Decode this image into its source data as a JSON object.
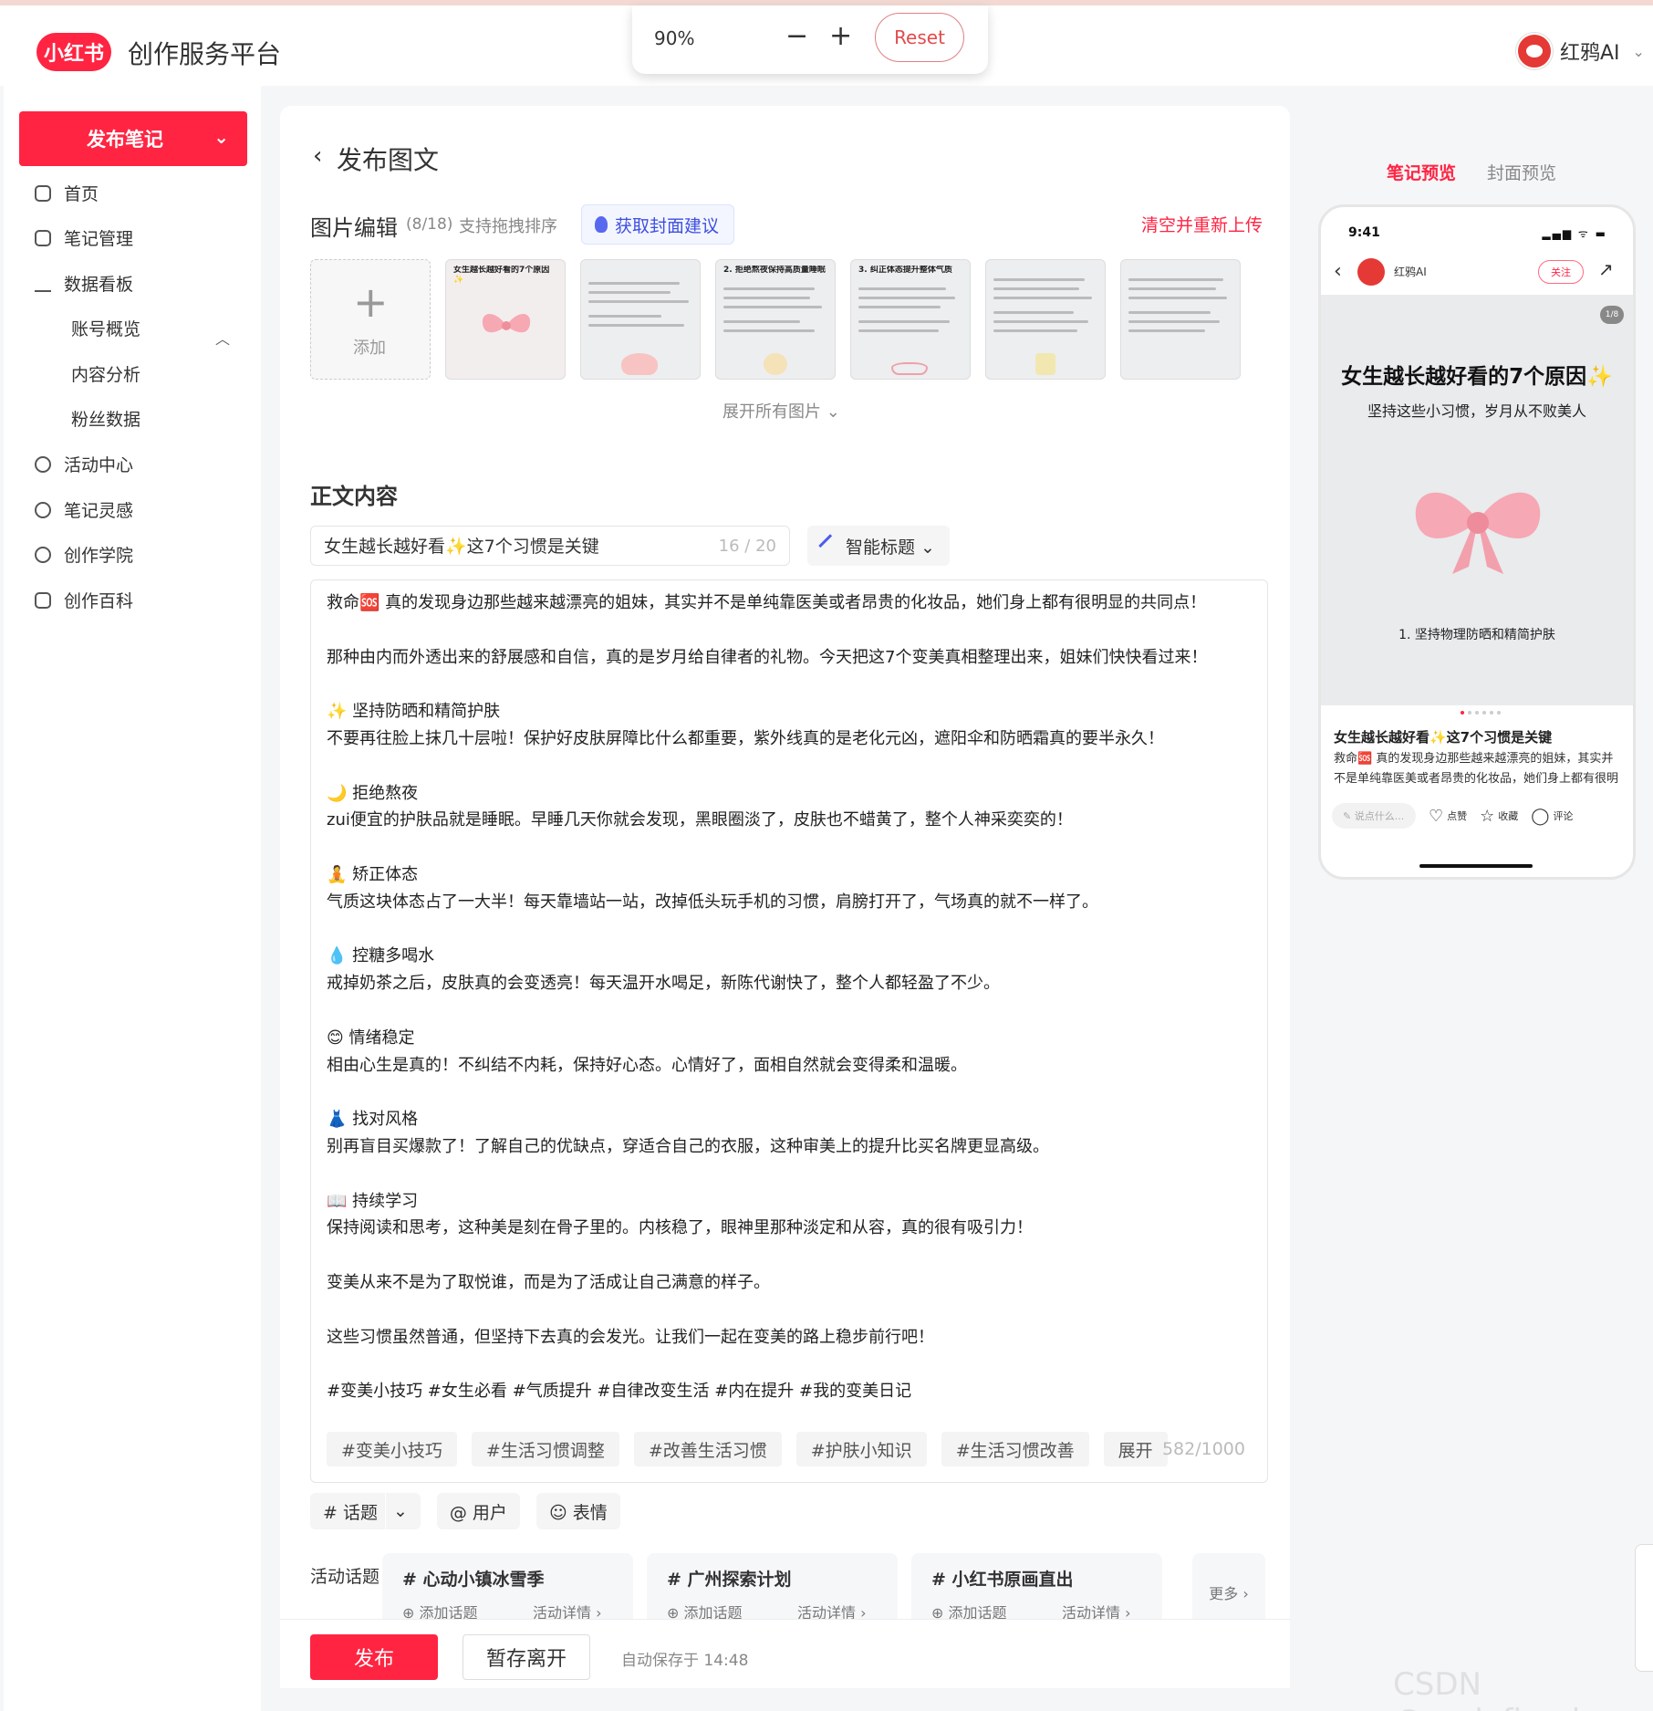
{
  "header": {
    "logo": "小红书",
    "title": "创作服务平台",
    "zoom": {
      "level": "90%",
      "minus": "−",
      "plus": "+",
      "reset": "Reset"
    },
    "user": {
      "name": "红鸦AI",
      "chevron": "⌄"
    }
  },
  "sidebar": {
    "publish_label": "发布笔记",
    "publish_chevron": "⌄",
    "items": [
      {
        "label": "首页",
        "icon": "home-icon"
      },
      {
        "label": "笔记管理",
        "icon": "note-icon"
      },
      {
        "label": "数据看板",
        "icon": "chart-icon"
      },
      {
        "label": "账号概览"
      },
      {
        "label": "内容分析"
      },
      {
        "label": "粉丝数据"
      },
      {
        "label": "活动中心",
        "icon": "activity-icon"
      },
      {
        "label": "笔记灵感",
        "icon": "inspiration-icon"
      },
      {
        "label": "创作学院",
        "icon": "academy-icon"
      },
      {
        "label": "创作百科",
        "icon": "wiki-icon"
      }
    ],
    "collapse_icon": "︿"
  },
  "page": {
    "back_icon": "‹",
    "title": "发布图文",
    "image_edit": {
      "title": "图片编辑",
      "count": "(8/18)",
      "hint": "支持拖拽排序",
      "cover_suggest": "获取封面建议",
      "clear_reupload": "清空并重新上传",
      "add_plus": "+",
      "add_label": "添加",
      "expand": "展开所有图片 ⌄",
      "thumbs": [
        {
          "title": "女生越长越好看的7个原因✨"
        },
        {
          "title": ""
        },
        {
          "title": "2. 拒绝熬夜保持高质量睡眠"
        },
        {
          "title": "3. 纠正体态提升整体气质"
        },
        {
          "title": ""
        },
        {
          "title": ""
        }
      ]
    },
    "body": {
      "title": "正文内容",
      "title_input": "女生越长越好看✨这7个习惯是关键",
      "title_count": "16 / 20",
      "smart_title": "智能标题 ⌄",
      "text": "救命🆘 真的发现身边那些越来越漂亮的姐妹，其实并不是单纯靠医美或者昂贵的化妆品，她们身上都有很明显的共同点！\n\n那种由内而外透出来的舒展感和自信，真的是岁月给自律者的礼物。今天把这7个变美真相整理出来，姐妹们快快看过来！\n\n✨ 坚持防晒和精简护肤\n不要再往脸上抹几十层啦！保护好皮肤屏障比什么都重要，紫外线真的是老化元凶，遮阳伞和防晒霜真的要半永久！\n\n🌙 拒绝熬夜\nzui便宜的护肤品就是睡眠。早睡几天你就会发现，黑眼圈淡了，皮肤也不蜡黄了，整个人神采奕奕的！\n\n🧘 矫正体态\n气质这块体态占了一大半！每天靠墙站一站，改掉低头玩手机的习惯，肩膀打开了，气场真的就不一样了。\n\n💧 控糖多喝水\n戒掉奶茶之后，皮肤真的会变透亮！每天温开水喝足，新陈代谢快了，整个人都轻盈了不少。\n\n😊 情绪稳定\n相由心生是真的！不纠结不内耗，保持好心态。心情好了，面相自然就会变得柔和温暖。\n\n👗 找对风格\n别再盲目买爆款了！了解自己的优缺点，穿适合自己的衣服，这种审美上的提升比买名牌更显高级。\n\n📖 持续学习\n保持阅读和思考，这种美是刻在骨子里的。内核稳了，眼神里那种淡定和从容，真的很有吸引力！\n\n变美从来不是为了取悦谁，而是为了活成让自己满意的样子。\n\n这些习惯虽然普通，但坚持下去真的会发光。让我们一起在变美的路上稳步前行吧！\n\n#变美小技巧 #女生必看 #气质提升 #自律改变生活 #内在提升 #我的变美日记",
      "tag_chips": [
        "#变美小技巧",
        "#生活习惯调整",
        "#改善生活习惯",
        "#护肤小知识",
        "#生活习惯改善",
        "展开"
      ],
      "text_count": "582/1000"
    },
    "tools": {
      "topic": "# 话题",
      "topic_chevron": "⌄",
      "user": "@ 用户",
      "emoji": "☺ 表情"
    },
    "activity": {
      "label": "活动话题",
      "cards": [
        {
          "title": "# 心动小镇冰雪季",
          "add": "⊕ 添加话题",
          "detail": "活动详情 ›"
        },
        {
          "title": "# 广州探索计划",
          "add": "⊕ 添加话题",
          "detail": "活动详情 ›"
        },
        {
          "title": "# 小红书原画直出",
          "add": "⊕ 添加话题",
          "detail": "活动详情 ›"
        }
      ],
      "more": "更多 ›"
    },
    "footer": {
      "publish": "发布",
      "save_leave": "暂存离开",
      "autosave": "自动保存于 14:48"
    }
  },
  "preview": {
    "tab_note": "笔记预览",
    "tab_cover": "封面预览",
    "phone": {
      "time": "9:41",
      "status": "▂▄▆ ᯤ ▬",
      "back": "‹",
      "author": "红鸦AI",
      "follow": "关注",
      "share": "↗",
      "badge": "1/8",
      "img_title": "女生越长越好看的7个原因✨",
      "img_subtitle": "坚持这些小习惯，岁月从不败美人",
      "img_item": "1. 坚持物理防晒和精简护肤",
      "note_title": "女生越长越好看✨这7个习惯是关键",
      "note_body": "救命🆘 真的发现身边那些越来越漂亮的姐妹，其实并不是单纯靠医美或者昂贵的化妆品，她们身上都有很明显的共同点！",
      "comment_placeholder": "✎ 说点什么...",
      "like": "点赞",
      "collect": "收藏",
      "comment": "评论"
    }
  },
  "watermark": "CSDN @undefined",
  "colors": {
    "brand": "#ff2442",
    "accent_blue": "#3d4fe0"
  }
}
